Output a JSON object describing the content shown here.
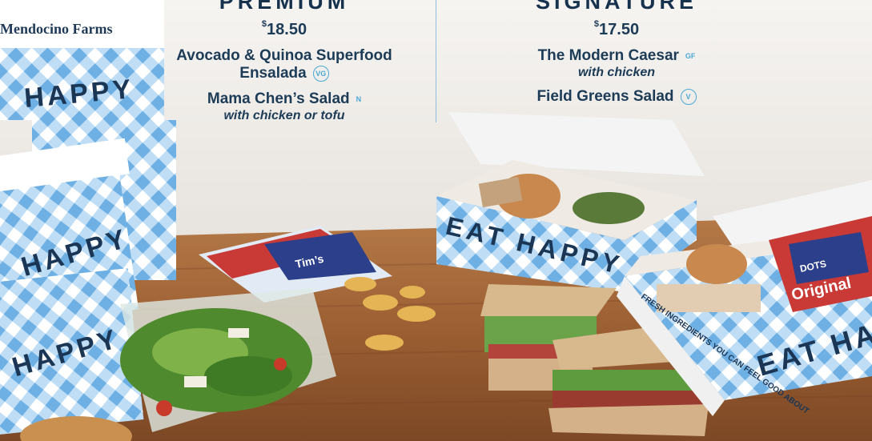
{
  "menu": {
    "premium": {
      "heading": "PREMIUM",
      "price_symbol": "$",
      "price": "18.50",
      "items": [
        {
          "name": "Avocado & Quinoa Superfood Ensalada",
          "badge": "VG"
        },
        {
          "name": "Mama Chen’s Salad",
          "badge": "N",
          "sub": "with chicken or tofu"
        }
      ]
    },
    "signature": {
      "heading": "SIGNATURE",
      "price_symbol": "$",
      "price": "17.50",
      "items": [
        {
          "name": "The Modern Caesar",
          "badge": "GF",
          "sub": "with chicken"
        },
        {
          "name": "Field Greens Salad",
          "badge": "V"
        }
      ]
    }
  },
  "photo": {
    "box_brand": "Mendocino Farms",
    "box_slogan_1": "HAPPY",
    "box_slogan_2": "EAT HAPPY",
    "box_tagline": "FRESH INGREDIENTS YOU CAN FEEL GOOD ABOUT",
    "chip_brand": "Tim’s",
    "chip_flavor": "Original",
    "chip_subtext": "DOTS"
  },
  "colors": {
    "navy": "#1c3b57",
    "badge_blue": "#4aa8d8",
    "gingham_blue": "#8ec3ea",
    "wood": "#a86a3a"
  }
}
